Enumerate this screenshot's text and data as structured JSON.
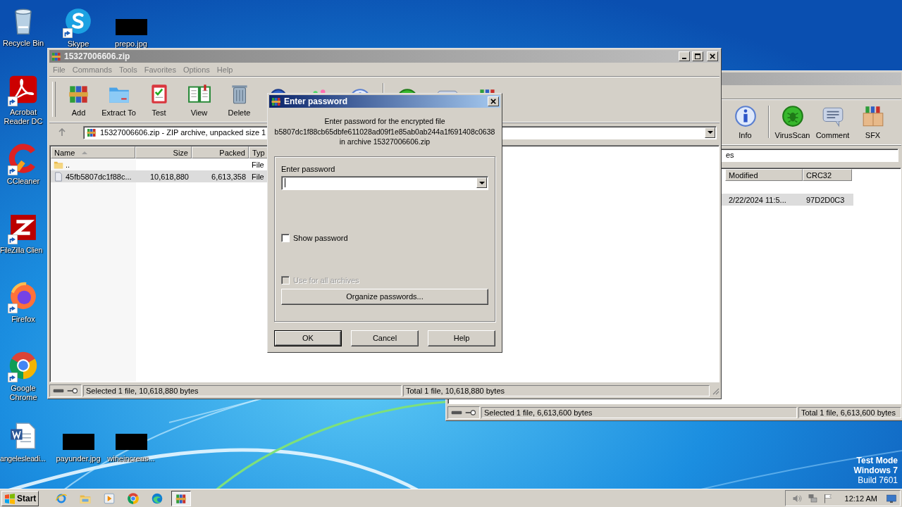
{
  "desktop": {
    "icons": [
      {
        "label": "Recycle Bin",
        "kind": "recycle",
        "shortcut": false
      },
      {
        "label": "Skype",
        "kind": "skype",
        "shortcut": true
      },
      {
        "label": "prepo.jpg",
        "kind": "redacted",
        "shortcut": false
      },
      {
        "label": "Acrobat Reader DC",
        "kind": "acrobat",
        "shortcut": true
      },
      {
        "label": "CCleaner",
        "kind": "ccleaner",
        "shortcut": true
      },
      {
        "label": "FileZilla Clien",
        "kind": "filezilla",
        "shortcut": true
      },
      {
        "label": "Firefox",
        "kind": "firefox",
        "shortcut": true
      },
      {
        "label": "Google Chrome",
        "kind": "chrome",
        "shortcut": true
      },
      {
        "label": "angelesleadi...",
        "kind": "word",
        "shortcut": false
      },
      {
        "label": "payunder.jpg",
        "kind": "redacted",
        "shortcut": false
      },
      {
        "label": "wineincreas...",
        "kind": "redacted",
        "shortcut": false
      }
    ],
    "os_notice": [
      "Test Mode",
      "Windows 7",
      "Build 7601"
    ]
  },
  "back_window": {
    "active": false,
    "toolbar": [
      {
        "label": "Info",
        "kind": "info"
      },
      {
        "label": "VirusScan",
        "kind": "virusscan"
      },
      {
        "label": "Comment",
        "kind": "comment"
      },
      {
        "label": "SFX",
        "kind": "sfx"
      }
    ],
    "address": "es",
    "columns": [
      "Modified",
      "CRC32"
    ],
    "rows": [
      {
        "cells": [
          "2/22/2024 11:5...",
          "97D2D0C3"
        ],
        "selected": true
      }
    ],
    "status": [
      "Selected 1 file, 6,613,600 bytes",
      "Total 1 file, 6,613,600 bytes"
    ]
  },
  "main_window": {
    "title": "15327006606.zip",
    "active": false,
    "menu": [
      {
        "label": "File",
        "disabled": true
      },
      {
        "label": "Commands",
        "disabled": true
      },
      {
        "label": "Tools",
        "disabled": true
      },
      {
        "label": "Favorites",
        "disabled": true
      },
      {
        "label": "Options",
        "disabled": true
      },
      {
        "label": "Help",
        "disabled": true
      }
    ],
    "toolbar": [
      {
        "label": "Add",
        "kind": "add"
      },
      {
        "label": "Extract To",
        "kind": "extract"
      },
      {
        "label": "Test",
        "kind": "test"
      },
      {
        "label": "View",
        "kind": "view"
      },
      {
        "label": "Delete",
        "kind": "delete"
      },
      {
        "kind": "find"
      },
      {
        "kind": "wizard"
      },
      {
        "kind": "info"
      },
      {
        "kind": "virusscan"
      },
      {
        "kind": "comment"
      },
      {
        "kind": "sfx"
      }
    ],
    "address": "15327006606.zip - ZIP archive, unpacked size 1",
    "columns": [
      {
        "label": "Name",
        "sorted": true
      },
      {
        "label": "Size"
      },
      {
        "label": "Packed"
      },
      {
        "label": "Typ"
      }
    ],
    "rows": [
      {
        "kind": "folder",
        "name": "..",
        "type": "File",
        "selected": false
      },
      {
        "kind": "file",
        "name": "45fb5807dc1f88c...",
        "size": "10,618,880",
        "packed": "6,613,358",
        "type": "File",
        "selected": true
      }
    ],
    "status": [
      "Selected 1 file, 10,618,880 bytes",
      "Total 1 file, 10,618,880 bytes"
    ]
  },
  "dialog": {
    "title": "Enter password",
    "message": [
      "Enter password for the encrypted file",
      "b5807dc1f88cb65dbfe611028ad09f1e85ab0ab244a1f691408c0638",
      "in archive 15327006606.zip"
    ],
    "field_label": "Enter password",
    "checkboxes": [
      {
        "label": "Show password",
        "checked": false,
        "disabled": false
      },
      {
        "label": "Use for all archives",
        "checked": false,
        "disabled": true
      }
    ],
    "organize_button": "Organize passwords...",
    "buttons": [
      {
        "label": "OK",
        "default": true
      },
      {
        "label": "Cancel",
        "default": false
      },
      {
        "label": "Help",
        "default": false
      }
    ]
  },
  "taskbar": {
    "start": "Start",
    "apps": [
      {
        "kind": "ie",
        "active": false
      },
      {
        "kind": "explorer",
        "active": false
      },
      {
        "kind": "media",
        "active": false
      },
      {
        "kind": "chrome",
        "active": false
      },
      {
        "kind": "edge",
        "active": false
      },
      {
        "kind": "add",
        "active": true
      }
    ],
    "tray": [
      {
        "kind": "speaker"
      },
      {
        "kind": "network"
      },
      {
        "kind": "flag"
      }
    ],
    "clock": "12:12 AM"
  }
}
